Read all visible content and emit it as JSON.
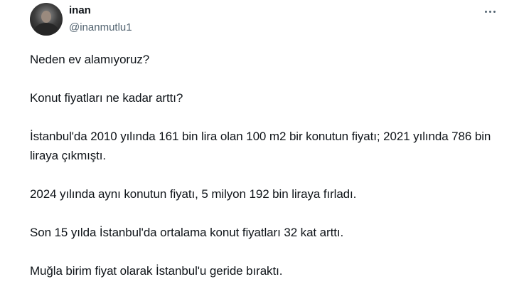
{
  "author": {
    "display_name": "inan",
    "handle": "@inanmutlu1"
  },
  "icons": {
    "more": "more-horizontal-icon",
    "avatar": "profile-photo"
  },
  "tweet": {
    "paragraphs": [
      "Neden ev alamıyoruz?",
      "Konut fiyatları ne kadar arttı?",
      "İstanbul'da 2010 yılında 161 bin lira olan 100 m2 bir konutun fiyatı; 2021 yılında 786 bin liraya çıkmıştı.",
      "2024 yılında aynı konutun fiyatı, 5 milyon 192 bin liraya fırladı.",
      "Son 15 yılda İstanbul'da ortalama konut fiyatları 32 kat arttı.",
      "Muğla birim fiyat olarak İstanbul'u geride bıraktı."
    ]
  },
  "colors": {
    "text": "#0f1419",
    "secondary": "#536471",
    "background": "#ffffff"
  }
}
